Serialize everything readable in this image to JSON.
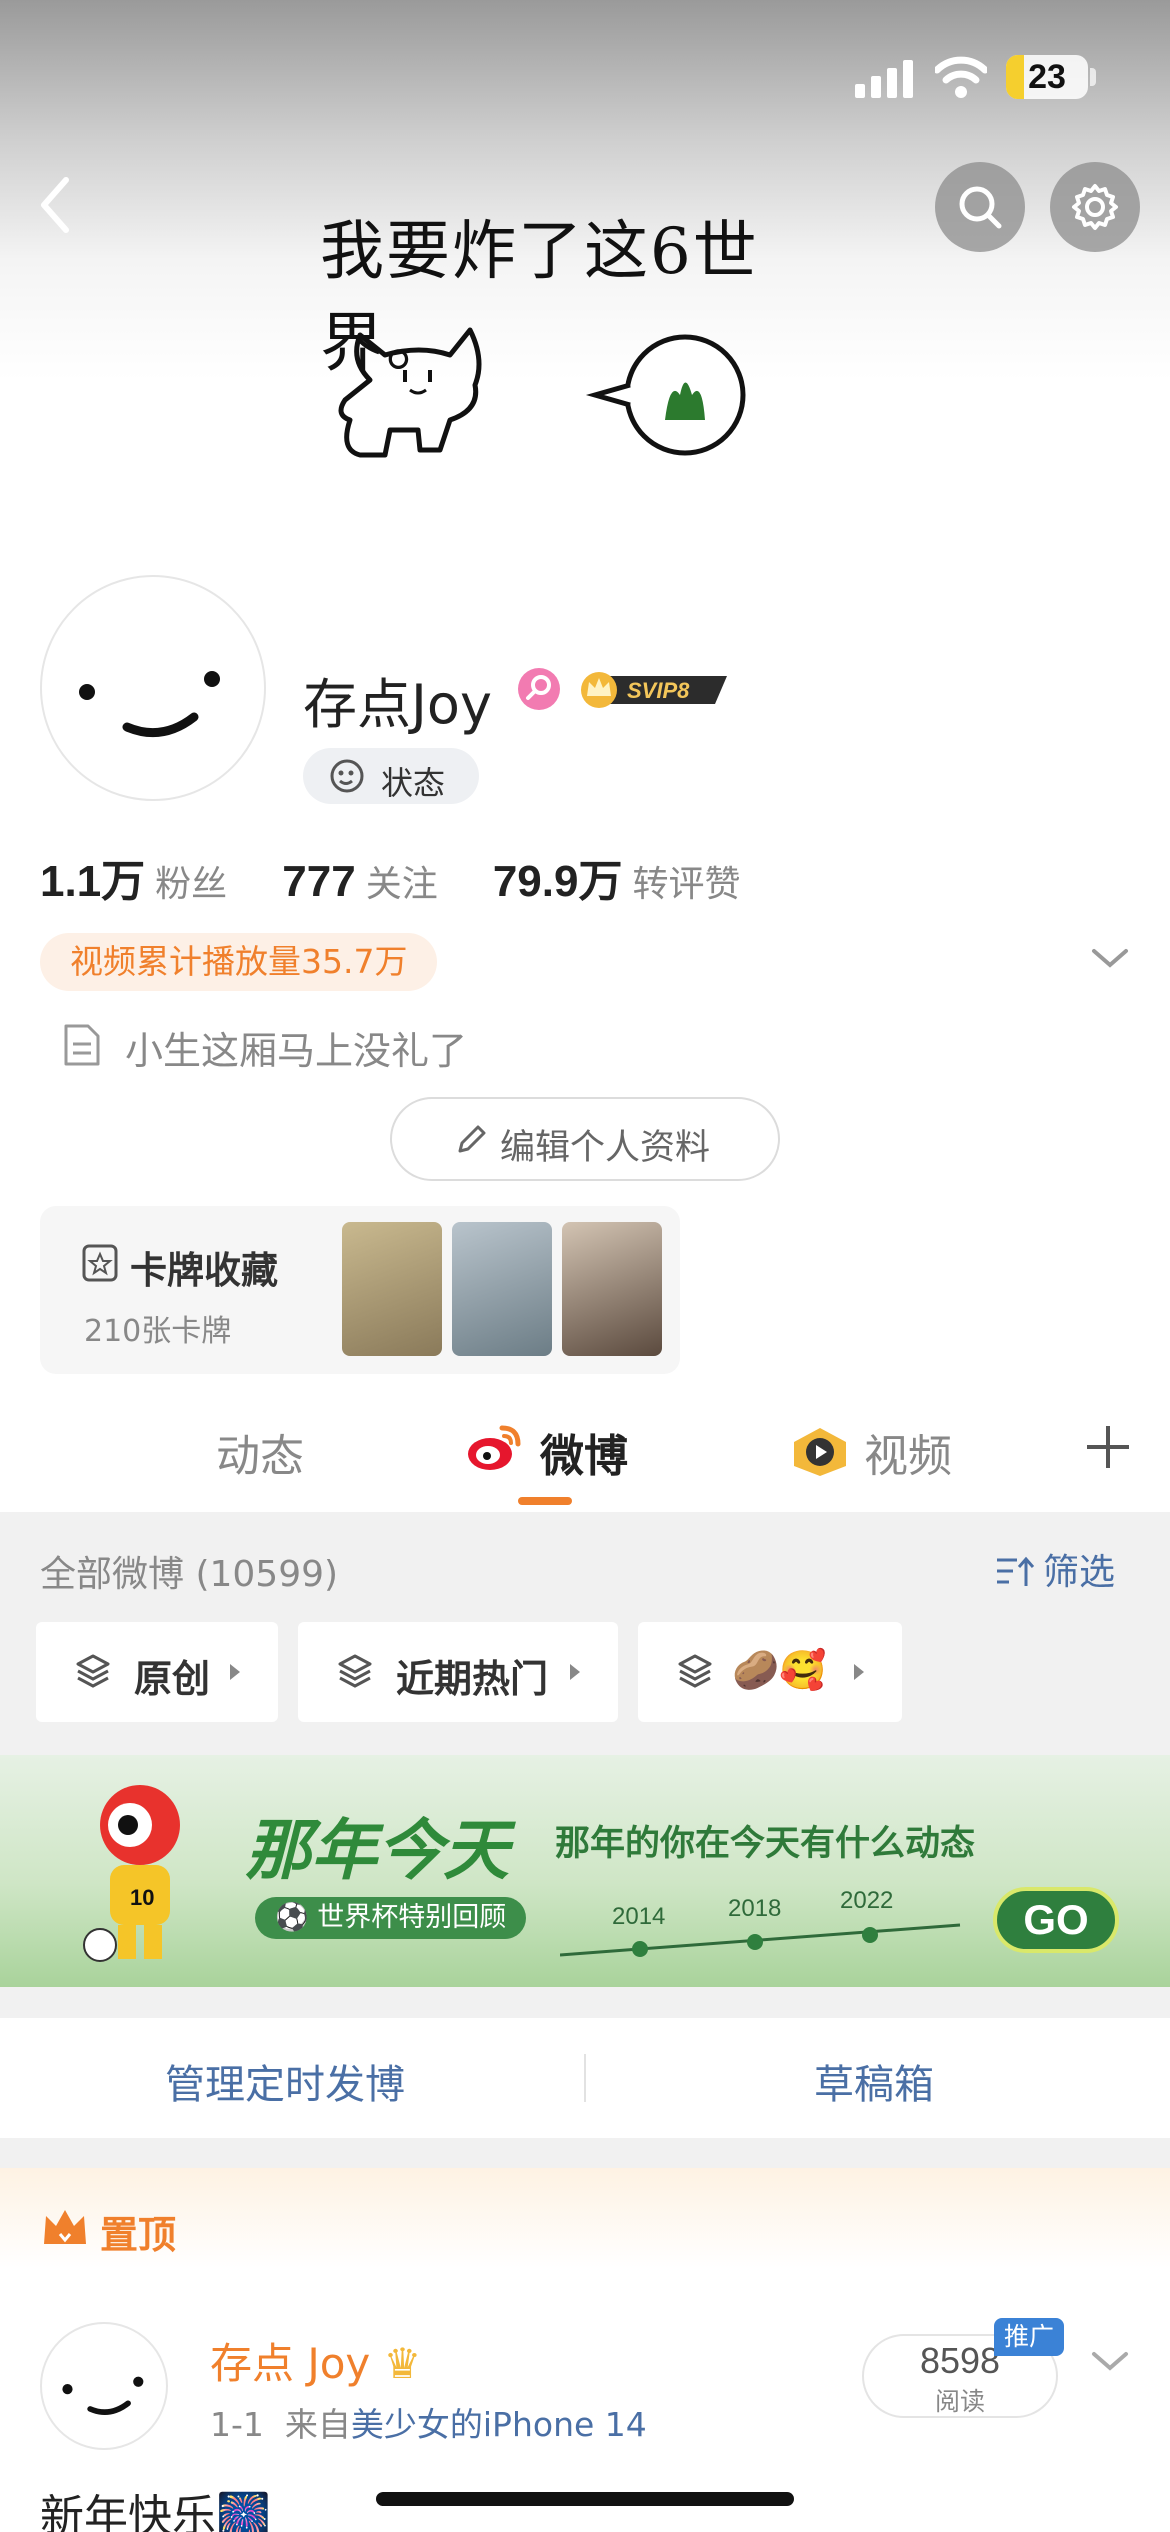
{
  "status_bar": {
    "battery": "23"
  },
  "header": {
    "cover_text": "我要炸了这6世界。"
  },
  "profile": {
    "username": "存点Joy",
    "svip": "SVIP8",
    "status_label": "状态",
    "stats": [
      {
        "num": "1.1万",
        "label": "粉丝"
      },
      {
        "num": "777",
        "label": "关注"
      },
      {
        "num": "79.9万",
        "label": "转评赞"
      }
    ],
    "video_plays": "视频累计播放量35.7万",
    "bio": "小生这厢马上没礼了",
    "edit_label": "编辑个人资料",
    "card_collection": {
      "title": "卡牌收藏",
      "count": "210张卡牌"
    }
  },
  "tabs": [
    {
      "label": "动态"
    },
    {
      "label": "微博"
    },
    {
      "label": "视频"
    }
  ],
  "weibo": {
    "all_label": "全部微博 (10599)",
    "filter_label": "筛选",
    "chips": [
      {
        "label": "原创"
      },
      {
        "label": "近期热门"
      },
      {
        "label": "🥔🥰"
      }
    ]
  },
  "banner": {
    "title": "那年今天",
    "subtitle": "那年的你在今天有什么动态",
    "tag": "世界杯特别回顾",
    "years": [
      "2014",
      "2018",
      "2022"
    ],
    "go": "GO"
  },
  "manage": {
    "scheduled": "管理定时发博",
    "drafts": "草稿箱"
  },
  "post": {
    "pin_label": "置顶",
    "author": "存点 Joy",
    "date": "1-1",
    "source_prefix": "来自",
    "source": "美少女的iPhone 14",
    "reads": "8598",
    "reads_label": "阅读",
    "promo": "推广",
    "text": "新年快乐🎆"
  },
  "colors": {
    "accent": "#f0802c",
    "link": "#4a6fa5",
    "banner_green": "#2f8a3a"
  }
}
